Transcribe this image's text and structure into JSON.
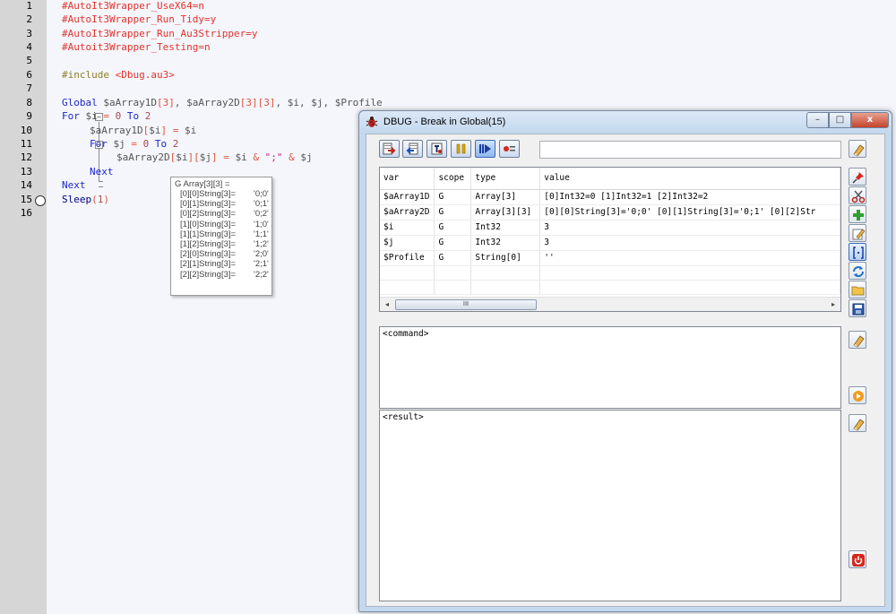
{
  "editor": {
    "line_numbers": [
      "1",
      "2",
      "3",
      "4",
      "5",
      "6",
      "7",
      "8",
      "9",
      "10",
      "11",
      "12",
      "13",
      "14",
      "15",
      "16"
    ],
    "lines": {
      "l1": "#AutoIt3Wrapper_UseX64=n",
      "l2": "#AutoIt3Wrapper_Run_Tidy=y",
      "l3": "#AutoIt3Wrapper_Run_Au3Stripper=y",
      "l4": "#Autoit3Wrapper_Testing=n",
      "l6_kw": "#include ",
      "l6_str": "<Dbug.au3>",
      "l8": {
        "global": "Global ",
        "v1": "$aArray1D",
        "b1": "[3]",
        "c1": ", ",
        "v2": "$aArray2D",
        "b2": "[3][3]",
        "c2": ", ",
        "v3": "$i",
        "c3": ", ",
        "v4": "$j",
        "c4": ", ",
        "v5": "$Profile"
      },
      "l9": {
        "kw1": "For ",
        "v": "$i",
        "op": " = ",
        "n1": "0",
        "kw2": " To ",
        "n2": "2"
      },
      "l10": {
        "v1": "$aArray1D",
        "b": "[",
        "v2": "$i",
        "b2": "]",
        "op": " = ",
        "v3": "$i"
      },
      "l11": {
        "kw1": "For ",
        "v": "$j",
        "op": " = ",
        "n1": "0",
        "kw2": " To ",
        "n2": "2"
      },
      "l12": {
        "v1": "$aArray2D",
        "b1": "[",
        "v2": "$i",
        "b2": "][",
        "v3": "$j",
        "b3": "]",
        "op1": " = ",
        "v4": "$i",
        "op2": " & ",
        "str": "\";\"",
        "op3": " & ",
        "v5": "$j"
      },
      "l13": "Next",
      "l14": "Next",
      "l15": {
        "fn": "Sleep",
        "p1": "(",
        "n": "1",
        "p2": ")"
      }
    }
  },
  "tooltip": {
    "title": "G Array[3][3] =",
    "rows": [
      {
        "key": "[0][0]String[3]=",
        "val": "'0;0'"
      },
      {
        "key": "[0][1]String[3]=",
        "val": "'0;1'"
      },
      {
        "key": "[0][2]String[3]=",
        "val": "'0;2'"
      },
      {
        "key": "[1][0]String[3]=",
        "val": "'1;0'"
      },
      {
        "key": "[1][1]String[3]=",
        "val": "'1;1'"
      },
      {
        "key": "[1][2]String[3]=",
        "val": "'1;2'"
      },
      {
        "key": "[2][0]String[3]=",
        "val": "'2;0'"
      },
      {
        "key": "[2][1]String[3]=",
        "val": "'2;1'"
      },
      {
        "key": "[2][2]String[3]=",
        "val": "'2;2'"
      }
    ]
  },
  "dbug": {
    "title": "DBUG - Break in Global(15)",
    "window_buttons": {
      "minimize": "–",
      "maximize": "□",
      "close": "x"
    },
    "command_input": "",
    "grid": {
      "headers": [
        "var",
        "scope",
        "type",
        "value"
      ],
      "rows": [
        [
          "$aArray1D",
          "G",
          "Array[3]",
          " [0]Int32=0  [1]Int32=1  [2]Int32=2"
        ],
        [
          "$aArray2D",
          "G",
          "Array[3][3]",
          " [0][0]String[3]='0;0'  [0][1]String[3]='0;1'  [0][2]Str"
        ],
        [
          "$i",
          "G",
          "Int32",
          "3"
        ],
        [
          "$j",
          "G",
          "Int32",
          "3"
        ],
        [
          "$Profile",
          "G",
          "String[0]",
          "''"
        ]
      ],
      "scroll_left": "◂",
      "scroll_right": "▸",
      "scroll_thumb": "III"
    },
    "command_text": "<command>",
    "result_text": "<result>"
  },
  "colors": {
    "gutter": "#d6d6d6",
    "editor_bg": "#f4f6fc",
    "directive": "#e2332c",
    "keyword": "#1c25c8",
    "window_frame": "#c4d8ee"
  }
}
